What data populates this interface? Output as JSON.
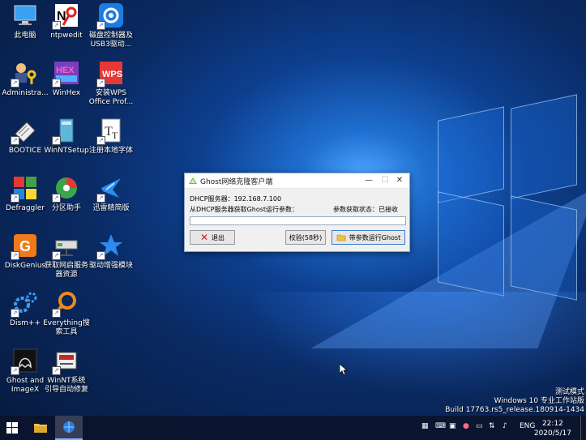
{
  "desktop": {
    "icons": [
      {
        "label": "此电脑",
        "label2": "",
        "icon": "computer-icon"
      },
      {
        "label": "ntpwedit",
        "label2": "",
        "icon": "ntpwedit-icon"
      },
      {
        "label": "磁盘控制器及",
        "label2": "USB3驱动...",
        "icon": "gear-blue-icon"
      },
      {
        "label": "Administra...",
        "label2": "",
        "icon": "admin-keys-icon"
      },
      {
        "label": "WinHex",
        "label2": "",
        "icon": "winhex-icon"
      },
      {
        "label": "安装WPS",
        "label2": "Office Prof...",
        "icon": "wps-icon"
      },
      {
        "label": "BOOTICE",
        "label2": "",
        "icon": "bootice-icon"
      },
      {
        "label": "WinNTSetup",
        "label2": "",
        "icon": "winntsetup-icon"
      },
      {
        "label": "注册本地字体",
        "label2": "",
        "icon": "font-icon"
      },
      {
        "label": "Defraggler",
        "label2": "",
        "icon": "defraggler-icon"
      },
      {
        "label": "分区助手",
        "label2": "",
        "icon": "partition-icon"
      },
      {
        "label": "迅雷精简版",
        "label2": "",
        "icon": "thunder-icon"
      },
      {
        "label": "DiskGenius",
        "label2": "",
        "icon": "diskgenius-icon"
      },
      {
        "label": "获取网启服务",
        "label2": "器资源",
        "icon": "network-drive-icon"
      },
      {
        "label": "驱动增强模块",
        "label2": "",
        "icon": "star-icon"
      },
      {
        "label": "Dism++",
        "label2": "",
        "icon": "dism-gear-icon"
      },
      {
        "label": "Everything搜",
        "label2": "索工具",
        "icon": "everything-search-icon"
      },
      {
        "label": "",
        "label2": "",
        "icon": "empty"
      },
      {
        "label": "Ghost and",
        "label2": "ImageX",
        "icon": "ghost-icon"
      },
      {
        "label": "WinNT系统",
        "label2": "引导自动修复",
        "icon": "repair-icon"
      }
    ]
  },
  "dialog": {
    "title": "Ghost网络克隆客户端",
    "dhcp_server": "DHCP服务器：192.168.7.100",
    "fetch_label": "从DHCP服务器获取Ghost运行参数：",
    "status_label": "参数获取状态：已接收",
    "input_value": "",
    "exit_button": "退出",
    "verify_button": "校验(58秒)",
    "run_button": "带参数运行Ghost",
    "min": "—",
    "max": "☐",
    "close": "✕"
  },
  "watermark": {
    "line1": "测试模式",
    "line2": "Windows 10 专业工作站版",
    "line3": "Build 17763.rs5_release.180914-1434"
  },
  "taskbar": {
    "lang": "ENG",
    "time": "22:12",
    "date": "2020/5/17"
  }
}
